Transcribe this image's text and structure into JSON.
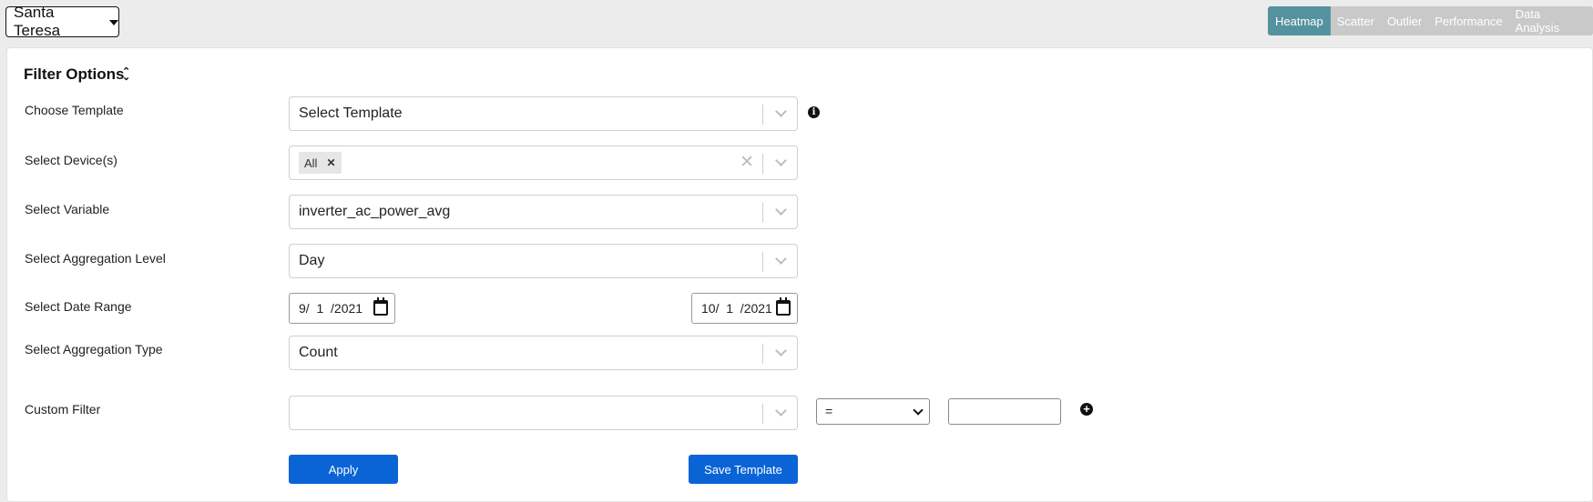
{
  "header": {
    "site": "Santa Teresa",
    "tabs": [
      {
        "label": "Heatmap",
        "active": true
      },
      {
        "label": "Scatter",
        "active": false
      },
      {
        "label": "Outlier",
        "active": false
      },
      {
        "label": "Performance",
        "active": false
      },
      {
        "label": "Data Analysis",
        "active": false
      }
    ]
  },
  "filter": {
    "title": "Filter Options",
    "template": {
      "label": "Choose Template",
      "value": "Select Template"
    },
    "devices": {
      "label": "Select Device(s)",
      "chip": "All"
    },
    "variable": {
      "label": "Select Variable",
      "value": "inverter_ac_power_avg"
    },
    "aggregation_level": {
      "label": "Select Aggregation Level",
      "value": "Day"
    },
    "date_range": {
      "label": "Select Date Range",
      "start": "9/  1  /2021",
      "end": "10/  1  /2021"
    },
    "aggregation_type": {
      "label": "Select Aggregation Type",
      "value": "Count"
    },
    "custom_filter": {
      "label": "Custom Filter",
      "field": "",
      "operator": "=",
      "value": ""
    },
    "apply_label": "Apply",
    "save_template_label": "Save Template"
  },
  "colors": {
    "active_tab": "#55929f",
    "inactive_tab": "#c9c9c9",
    "primary_button": "#0a64d6"
  }
}
